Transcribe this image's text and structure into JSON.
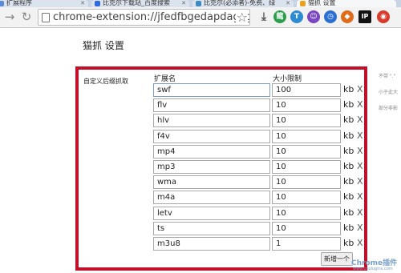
{
  "tabs": [
    {
      "label": "扩展程序",
      "color": "#5b8bd6"
    },
    {
      "label": "比克尔下载站_百度搜索",
      "color": "#2f6bdc"
    },
    {
      "label": "比克尔(必添者)-免费、绿",
      "color": "#3a8ac4"
    },
    {
      "label": "猫抓 设置",
      "color": "#e8a21e"
    }
  ],
  "toolbar": {
    "url": "chrome-extension://jfedfbgedapdagkghmgiben",
    "extensions": [
      {
        "name": "download-icon",
        "glyph": "⤓",
        "color": "#555555"
      },
      {
        "name": "dragon-icon",
        "glyph": "龍",
        "color": "#2a9d4a"
      },
      {
        "name": "translate-icon",
        "glyph": "T",
        "color": "#2c8bd3"
      },
      {
        "name": "emoji-icon",
        "glyph": "☺",
        "color": "#7a45c2"
      },
      {
        "name": "clock-icon",
        "glyph": "◷",
        "color": "#2a6fd1"
      },
      {
        "name": "tag-icon",
        "glyph": "◆",
        "color": "#e06b1b"
      },
      {
        "name": "ip-icon",
        "glyph": "IP",
        "color": "#111111"
      },
      {
        "name": "cat-icon",
        "glyph": "◉",
        "color": "#d83a2b"
      }
    ]
  },
  "page": {
    "title": "猫抓 设置",
    "section_label": "自定义后缀抓取",
    "col_ext": "扩展名",
    "col_size": "大小限制",
    "unit": "kb",
    "delete": "X",
    "add_button": "新增一个",
    "accent": "#c2102a"
  },
  "rows": [
    {
      "ext": "swf",
      "size": "100"
    },
    {
      "ext": "flv",
      "size": "10"
    },
    {
      "ext": "hlv",
      "size": "10"
    },
    {
      "ext": "f4v",
      "size": "10"
    },
    {
      "ext": "mp4",
      "size": "10"
    },
    {
      "ext": "mp3",
      "size": "10"
    },
    {
      "ext": "wma",
      "size": "10"
    },
    {
      "ext": "m4a",
      "size": "10"
    },
    {
      "ext": "letv",
      "size": "10"
    },
    {
      "ext": "ts",
      "size": "10"
    },
    {
      "ext": "m3u8",
      "size": "1"
    }
  ],
  "side_notes": [
    "不带 \".\"",
    "小于此大",
    "部分非影"
  ],
  "watermark": {
    "main": "Chrome插件",
    "sub": "www.cnplugins.com"
  }
}
